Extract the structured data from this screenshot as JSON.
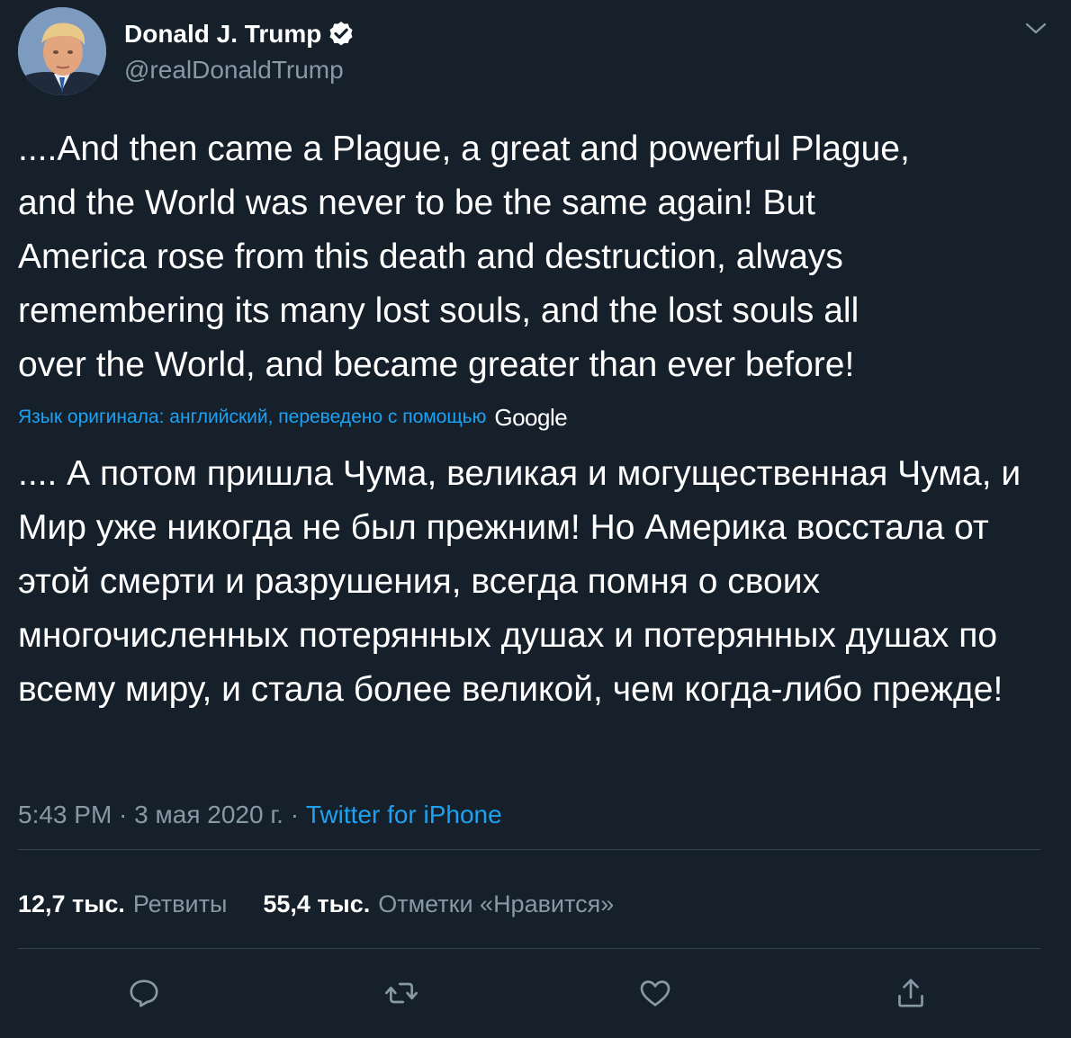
{
  "author": {
    "display_name": "Donald J. Trump",
    "handle": "@realDonaldTrump",
    "verified": true,
    "avatar_icon": "avatar-photo"
  },
  "tweet": {
    "text": "....And then came a Plague, a great and powerful Plague,\nand the World was never to be the same again! But\nAmerica rose from this death and destruction, always\nremembering its many lost souls, and the lost souls all\nover the World, and became greater than ever before!",
    "translation_label": "Язык оригинала: английский, переведено с помощью",
    "translation_provider": "Google",
    "translated_text": ".... А потом пришла Чума, великая и могущественная Чума, и Мир уже никогда не был прежним! Но Америка восстала от этой смерти и разрушения, всегда помня о своих многочисленных потерянных душах и потерянных душах по всему миру, и стала более великой, чем когда-либо прежде!"
  },
  "meta": {
    "time": "5:43 PM",
    "separator": " · ",
    "date": "3 мая 2020 г.",
    "source": "Twitter for iPhone"
  },
  "stats": {
    "retweets_count": "12,7 тыс.",
    "retweets_label": "Ретвиты",
    "likes_count": "55,4 тыс.",
    "likes_label": "Отметки «Нравится»"
  },
  "actions": [
    "reply-icon",
    "retweet-icon",
    "like-icon",
    "share-icon"
  ],
  "colors": {
    "background": "#15202b",
    "accent": "#1da1f2",
    "secondary_text": "#8899a6",
    "divider": "#38444d"
  }
}
